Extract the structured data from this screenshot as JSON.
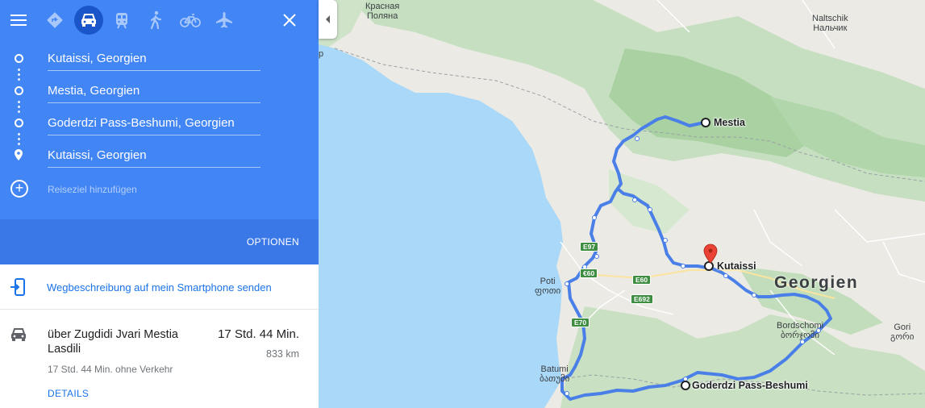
{
  "toolbar": {
    "menu_icon": "menu-icon",
    "modes": [
      {
        "name": "best-route",
        "icon": "directions-diamond-icon"
      },
      {
        "name": "car",
        "icon": "car-icon",
        "active": true
      },
      {
        "name": "transit",
        "icon": "train-icon"
      },
      {
        "name": "walk",
        "icon": "walk-icon"
      },
      {
        "name": "bike",
        "icon": "bike-icon"
      },
      {
        "name": "flight",
        "icon": "plane-icon"
      }
    ],
    "close_icon": "close-icon"
  },
  "waypoints": [
    {
      "value": "Kutaissi, Georgien"
    },
    {
      "value": "Mestia, Georgien"
    },
    {
      "value": "Goderdzi Pass-Beshumi, Georgien"
    },
    {
      "value": "Kutaissi, Georgien"
    }
  ],
  "add_destination": "Reiseziel hinzufügen",
  "options_label": "OPTIONEN",
  "send_to_phone": "Wegbeschreibung auf mein Smartphone senden",
  "route": {
    "via": "über Zugdidi Jvari Mestia Lasdili",
    "duration": "17 Std. 44 Min.",
    "distance": "833 km",
    "no_traffic": "17 Std. 44 Min. ohne Verkehr",
    "details": "DETAILS"
  },
  "map": {
    "country_label": "Georgien",
    "stops": {
      "mestia": "Mestia",
      "kutaissi": "Kutaissi",
      "goderdzi": "Goderdzi Pass-Beshumi"
    },
    "cities": {
      "krasnaya_line1": "Красная",
      "krasnaya_line2": "Поляна",
      "nalchik_line1": "Naltschik",
      "nalchik_line2": "Нальчик",
      "poti_line1": "Poti",
      "poti_line2": "ფოთი",
      "batumi_line1": "Batumi",
      "batumi_line2": "ბათუმი",
      "borjomi_line1": "Bordschomi",
      "borjomi_line2": "ბორჯომი",
      "gori_line1": "Gori",
      "gori_line2": "გორი",
      "sochi_fragment": "р"
    },
    "road_shields": {
      "e97": "E97",
      "e60a": "€60",
      "e60b": "E60",
      "e692": "E692",
      "e70": "E70"
    },
    "colors": {
      "route": "#4a7fe8",
      "sea": "#a9d8f9",
      "land": "#eceae4",
      "mountain": "#b9dab4",
      "panel_blue": "#4285f4",
      "pin": "#ea4335"
    }
  }
}
